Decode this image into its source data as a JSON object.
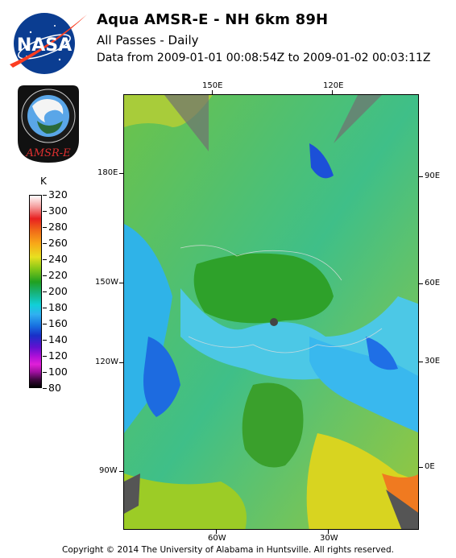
{
  "header": {
    "title": "Aqua AMSR-E - NH 6km 89H",
    "subtitle": "All Passes - Daily",
    "date_range": "Data from 2009-01-01 00:08:54Z to 2009-01-02 00:03:11Z"
  },
  "logos": {
    "nasa": {
      "text": "NASA",
      "icon": "nasa-meatball-logo"
    },
    "amsr": {
      "text": "AMSR-E",
      "icon": "amsr-e-mission-patch"
    }
  },
  "colorbar": {
    "unit": "K",
    "ticks": [
      "320",
      "300",
      "280",
      "260",
      "240",
      "220",
      "200",
      "180",
      "160",
      "140",
      "120",
      "100",
      "80"
    ],
    "min": 80,
    "max": 320
  },
  "map": {
    "top_labels": [
      "150E",
      "120E"
    ],
    "bottom_labels": [
      "60W",
      "30W"
    ],
    "left_labels": [
      "180E",
      "150W",
      "120W",
      "90W"
    ],
    "right_labels": [
      "90E",
      "60E",
      "30E",
      "0E"
    ]
  },
  "footer": {
    "copyright": "Copyright © 2014 The University of Alabama in Huntsville. All rights reserved."
  }
}
